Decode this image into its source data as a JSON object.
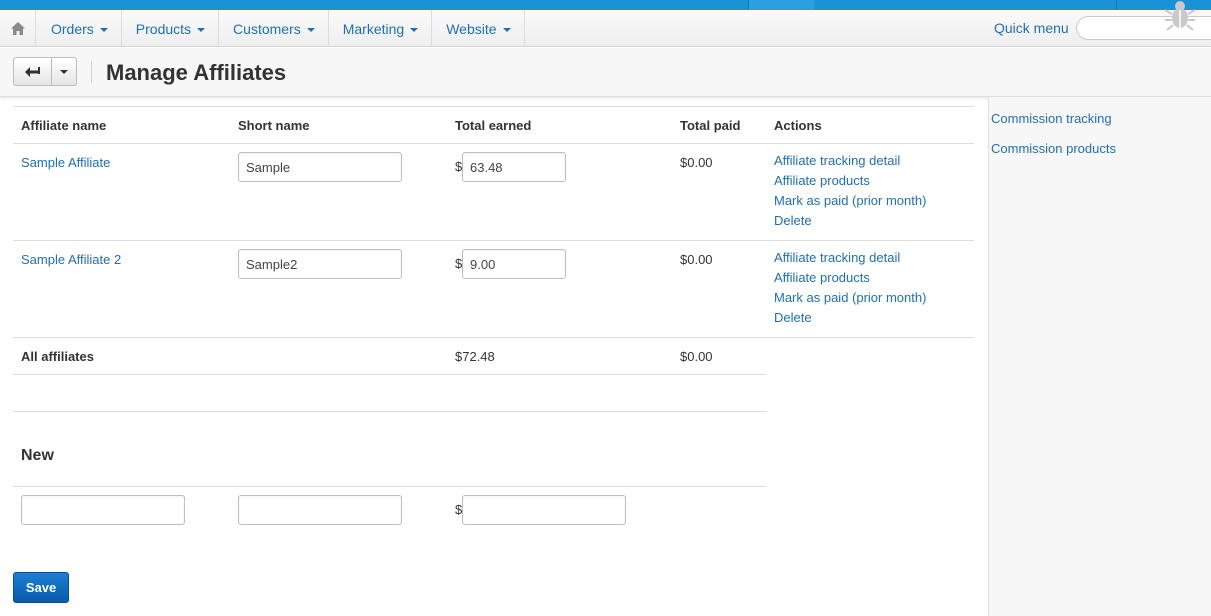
{
  "nav": {
    "menus": [
      {
        "label": "Orders"
      },
      {
        "label": "Products"
      },
      {
        "label": "Customers"
      },
      {
        "label": "Marketing"
      },
      {
        "label": "Website"
      }
    ],
    "quick_menu": "Quick menu",
    "search_value": ""
  },
  "page": {
    "title": "Manage Affiliates"
  },
  "table": {
    "headers": {
      "affiliate_name": "Affiliate name",
      "short_name": "Short name",
      "total_earned": "Total earned",
      "total_paid": "Total paid",
      "actions": "Actions"
    },
    "currency_symbol": "$",
    "rows": [
      {
        "name": "Sample Affiliate",
        "short_name": "Sample",
        "total_earned": "63.48",
        "total_paid": "$0.00",
        "actions": [
          "Affiliate tracking detail",
          "Affiliate products",
          "Mark as paid (prior month)",
          "Delete"
        ]
      },
      {
        "name": "Sample Affiliate 2",
        "short_name": "Sample2",
        "total_earned": "9.00",
        "total_paid": "$0.00",
        "actions": [
          "Affiliate tracking detail",
          "Affiliate products",
          "Mark as paid (prior month)",
          "Delete"
        ]
      }
    ],
    "totals": {
      "label": "All affiliates",
      "earned": "$72.48",
      "paid": "$0.00"
    }
  },
  "new_section": {
    "title": "New",
    "name_value": "",
    "short_name_value": "",
    "amount_value": ""
  },
  "sidebar": {
    "links": [
      "Commission tracking",
      "Commission products"
    ]
  },
  "buttons": {
    "save": "Save"
  },
  "colors": {
    "accent": "#1a93d6",
    "link": "#1f6fb5",
    "save": "#0b5aa8"
  }
}
